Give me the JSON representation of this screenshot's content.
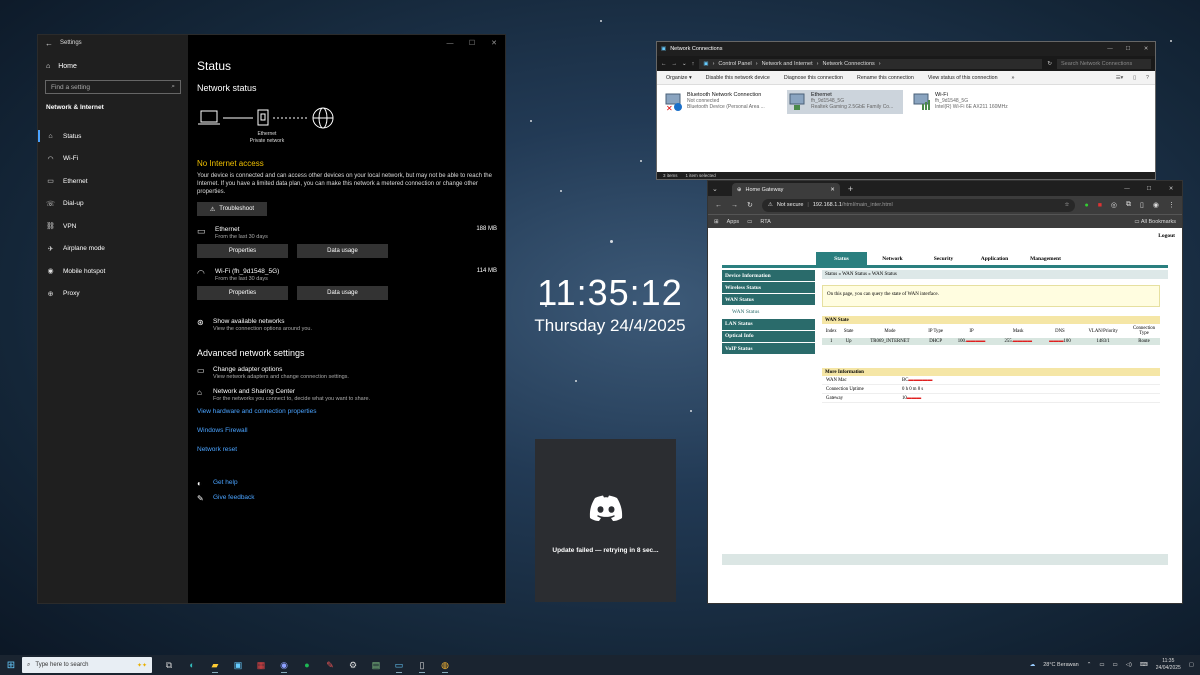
{
  "settings": {
    "window_title": "Settings",
    "nav": {
      "home": "Home",
      "search_placeholder": "Find a setting",
      "section": "Network & Internet",
      "items": [
        {
          "label": "Status",
          "icon": "home-wifi-icon"
        },
        {
          "label": "Wi-Fi",
          "icon": "wifi-icon"
        },
        {
          "label": "Ethernet",
          "icon": "ethernet-icon"
        },
        {
          "label": "Dial-up",
          "icon": "dialup-icon"
        },
        {
          "label": "VPN",
          "icon": "vpn-icon"
        },
        {
          "label": "Airplane mode",
          "icon": "airplane-icon"
        },
        {
          "label": "Mobile hotspot",
          "icon": "hotspot-icon"
        },
        {
          "label": "Proxy",
          "icon": "globe-icon"
        }
      ]
    },
    "main": {
      "title": "Status",
      "network_status": "Network status",
      "diagram_label_1": "Ethernet",
      "diagram_label_2": "Private network",
      "no_internet": "No Internet access",
      "description": "Your device is connected and can access other devices on your local network, but may not be able to reach the Internet. If you have a limited data plan, you can make this network a metered connection or change other properties.",
      "troubleshoot": "Troubleshoot",
      "ethernet": {
        "name": "Ethernet",
        "sub": "From the last 30 days",
        "size": "188 MB"
      },
      "wifi": {
        "name": "Wi-Fi (fh_9d1548_5G)",
        "sub": "From the last 30 days",
        "size": "114 MB"
      },
      "properties": "Properties",
      "data_usage": "Data usage",
      "show_networks": "Show available networks",
      "show_networks_sub": "View the connection options around you.",
      "advanced": "Advanced network settings",
      "change_adapter": "Change adapter options",
      "change_adapter_sub": "View network adapters and change connection settings.",
      "sharing_center": "Network and Sharing Center",
      "sharing_center_sub": "For the networks you connect to, decide what you want to share.",
      "view_hw": "View hardware and connection properties",
      "firewall": "Windows Firewall",
      "reset": "Network reset",
      "get_help": "Get help",
      "feedback": "Give feedback"
    }
  },
  "netconn": {
    "title": "Network Connections",
    "path": [
      "Control Panel",
      "Network and Internet",
      "Network Connections"
    ],
    "search_placeholder": "Search Network Connections",
    "commands": [
      "Organize ▾",
      "Disable this network device",
      "Diagnose this connection",
      "Rename this connection",
      "View status of this connection",
      "»"
    ],
    "adapters": [
      {
        "name": "Bluetooth Network Connection",
        "status": "Not connected",
        "device": "Bluetooth Device (Personal Area ..."
      },
      {
        "name": "Ethernet",
        "status": "fh_9d1548_5G",
        "device": "Realtek Gaming 2.5GbE Family Co..."
      },
      {
        "name": "Wi-Fi",
        "status": "fh_9d1548_5G",
        "device": "Intel(R) Wi-Fi 6E AX211 160MHz"
      }
    ],
    "status_items": "3 items",
    "status_selected": "1 item selected"
  },
  "clock": {
    "time": "11:35:12",
    "date": "Thursday 24/4/2025"
  },
  "discord": {
    "message": "Update failed — retrying in 8 sec..."
  },
  "browser": {
    "tab_title": "Home Gateway",
    "not_secure": "Not secure",
    "url_host": "192.168.1.1",
    "url_path": "/html/main_inter.html",
    "bookmarks": [
      "Apps",
      "RTA"
    ],
    "all_bookmarks": "All Bookmarks",
    "router": {
      "logout": "Logout",
      "tabs": [
        "Status",
        "Network",
        "Security",
        "Application",
        "Management"
      ],
      "side": [
        "Device Information",
        "Wireless Status",
        "WAN Status",
        "WAN Status",
        "LAN Status",
        "Optical Info",
        "VoIP Status"
      ],
      "crumb": "Status » WAN Status » WAN Status",
      "notice": "On this page, you can query the state of WAN interface.",
      "wan_state": "WAN State",
      "headers": [
        "Index",
        "State",
        "Mode",
        "IP Type",
        "IP",
        "Mask",
        "DNS",
        "VLAN/Priority",
        "Connection Type"
      ],
      "row": [
        "1",
        "Up",
        "TR069_INTERNET",
        "DHCP",
        "100.",
        "255.",
        "100",
        "1483/1",
        "Route"
      ],
      "more_info": "More Information",
      "kv": [
        {
          "k": "WAN Mac",
          "v": "BC"
        },
        {
          "k": "Connection Uptime",
          "v": "0 h 0 m 8 s"
        },
        {
          "k": "Gateway",
          "v": "10"
        }
      ]
    }
  },
  "taskbar": {
    "search_placeholder": "Type here to search",
    "weather": "28°C  Berawan",
    "time": "11:35",
    "date": "24/04/2025"
  }
}
